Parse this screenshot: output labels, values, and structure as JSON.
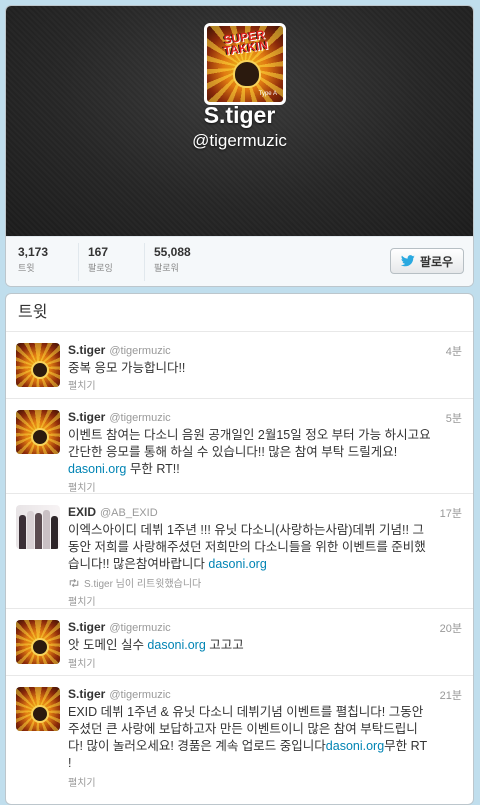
{
  "profile": {
    "display_name": "S.tiger",
    "screen_name": "@tigermuzic",
    "avatar_logo_text": "SUPER TAKKIN",
    "avatar_caption": "Type A"
  },
  "stats": [
    {
      "value": "3,173",
      "label": "트윗"
    },
    {
      "value": "167",
      "label": "팔로잉"
    },
    {
      "value": "55,088",
      "label": "팔로워"
    }
  ],
  "follow_button": {
    "label": "팔로우",
    "icon": "twitter-bird-icon"
  },
  "tweets_heading": "트윗",
  "tweets": [
    {
      "name": "S.tiger",
      "handle": "@tigermuzic",
      "time": "4분",
      "text": "중복 응모 가능합니다!!",
      "expand": "펼치기"
    },
    {
      "name": "S.tiger",
      "handle": "@tigermuzic",
      "time": "5분",
      "text_line1": "이벤트 참여는 다소니 음원 공개일인 2월15일 정오 부터 가능 하시고요",
      "text_line2": "간단한 응모를 통해 하실 수 있습니다!! 많은 참여 부탁 드릴게요!",
      "link": "dasoni.org",
      "text_after_link": " 무한 RT!!",
      "expand": "펼치기"
    },
    {
      "name": "EXID",
      "handle": "@AB_EXID",
      "time": "17분",
      "text_line1": "이엑스아이디 데뷔 1주년 !!! 유닛 다소니(사랑하는사람)데뷔 기념!! 그",
      "text_line2": "동안 저희를 사랑해주셨던 저희만의 다소니들을 위한 이벤트를 준비했",
      "text_line3": "습니다!! 많은참여바랍니다 ",
      "link": "dasoni.org",
      "retweeted_by": "S.tiger 님이 리트윗했습니다",
      "expand": "펼치기"
    },
    {
      "name": "S.tiger",
      "handle": "@tigermuzic",
      "time": "20분",
      "text_before_link": "앗 도메인 실수 ",
      "link": "dasoni.org",
      "text_after_link": " 고고고",
      "expand": "펼치기"
    },
    {
      "name": "S.tiger",
      "handle": "@tigermuzic",
      "time": "21분",
      "text_line1": "EXID 데뷔 1주년 & 유닛 다소니 데뷔기념 이벤트를 펼칩니다! 그동안",
      "text_line2": "주셨던 큰 사랑에 보답하고자 만든 이벤트이니 많은 참여 부탁드립니",
      "text_line3": "다! 많이 놀러오세요! 경품은 계속 업로드 중입니다",
      "link": "dasoni.org",
      "text_after_link": "무한 RT",
      "text_line4": "!",
      "expand": "펼치기"
    }
  ],
  "colors": {
    "background": "#c0deed",
    "link": "#0084b4",
    "header_dark": "#262626"
  }
}
